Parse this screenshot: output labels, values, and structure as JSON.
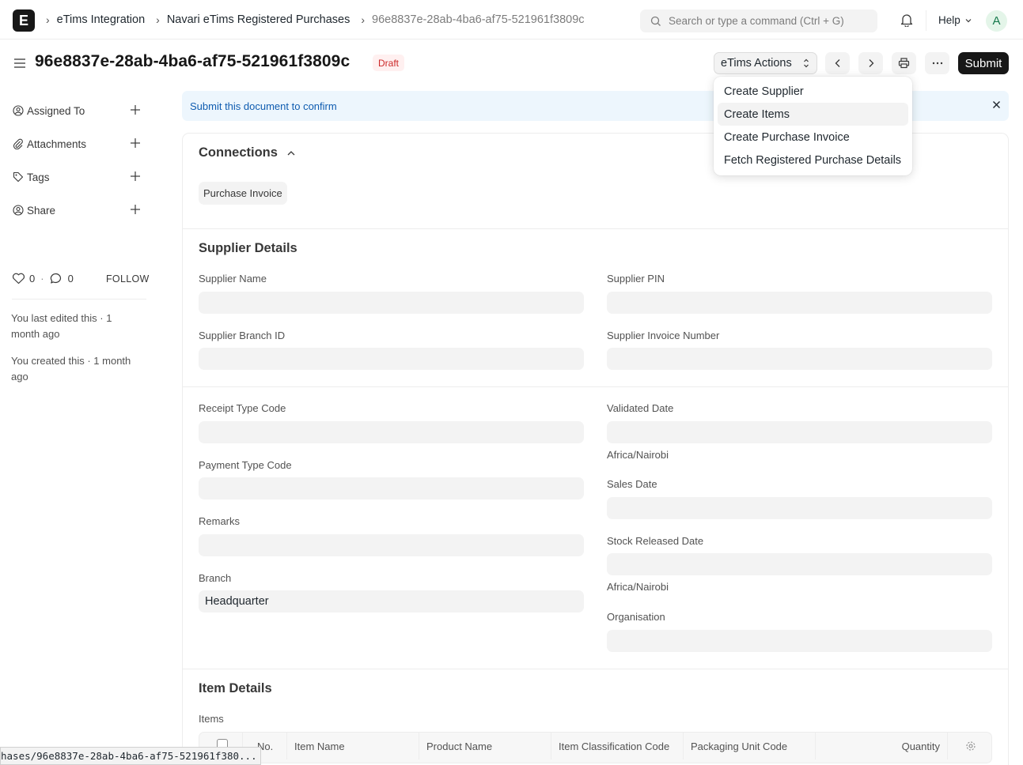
{
  "navbar": {
    "logo_letter": "E",
    "breadcrumbs": [
      "eTims Integration",
      "Navari eTims Registered Purchases",
      "96e8837e-28ab-4ba6-af75-521961f3809c"
    ],
    "search_placeholder": "Search or type a command (Ctrl + G)",
    "help_label": "Help",
    "avatar_letter": "A"
  },
  "page": {
    "title": "96e8837e-28ab-4ba6-af75-521961f3809c",
    "status": "Draft",
    "actions_label": "eTims Actions",
    "submit_label": "Submit"
  },
  "actions_menu": {
    "items": [
      "Create Supplier",
      "Create Items",
      "Create Purchase Invoice",
      "Fetch Registered Purchase Details"
    ],
    "highlighted": "Create Items"
  },
  "sidebar": {
    "items": [
      {
        "label": "Assigned To",
        "icon": "assign-icon"
      },
      {
        "label": "Attachments",
        "icon": "paperclip-icon"
      },
      {
        "label": "Tags",
        "icon": "tag-icon"
      },
      {
        "label": "Share",
        "icon": "share-icon"
      }
    ],
    "likes": "0",
    "comments": "0",
    "follow_label": "FOLLOW",
    "last_edited": "You last edited this · 1 month ago",
    "created": "You created this · 1 month ago"
  },
  "alert": {
    "message": "Submit this document to confirm"
  },
  "connections": {
    "title": "Connections",
    "links": [
      "Purchase Invoice"
    ]
  },
  "supplier_details": {
    "title": "Supplier Details",
    "supplier_name_label": "Supplier Name",
    "supplier_name": "",
    "supplier_pin_label": "Supplier PIN",
    "supplier_pin": "",
    "branch_id_label": "Supplier Branch ID",
    "branch_id": "",
    "invoice_number_label": "Supplier Invoice Number",
    "invoice_number": ""
  },
  "details": {
    "receipt_type_label": "Receipt Type Code",
    "receipt_type": "",
    "payment_type_label": "Payment Type Code",
    "payment_type": "",
    "remarks_label": "Remarks",
    "remarks": "",
    "branch_label": "Branch",
    "branch": "Headquarter",
    "validated_date_label": "Validated Date",
    "validated_date": "",
    "timezone": "Africa/Nairobi",
    "sales_date_label": "Sales Date",
    "sales_date": "",
    "stock_released_label": "Stock Released Date",
    "stock_released": "",
    "organisation_label": "Organisation",
    "organisation": ""
  },
  "item_details": {
    "title": "Item Details",
    "items_label": "Items",
    "columns": [
      "No.",
      "Item Name",
      "Product Name",
      "Item Classification Code",
      "Packaging Unit Code",
      "Quantity"
    ]
  },
  "status_bar": {
    "url": "hases/96e8837e-28ab-4ba6-af75-521961f380..."
  }
}
